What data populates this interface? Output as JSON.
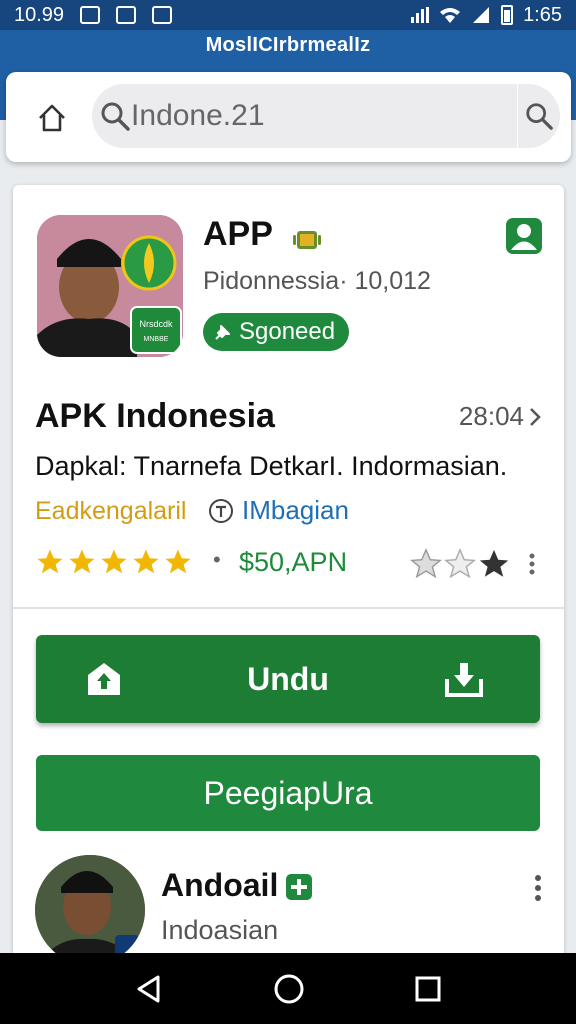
{
  "status_bar": {
    "time_left": "10.99",
    "time_right": "1:65"
  },
  "header": {
    "title": "MoslICIrbrmealIz"
  },
  "search": {
    "value": "Indone.21"
  },
  "app": {
    "title": "APP",
    "developer_line": "Pidonnessia· 10,012",
    "verified_label": "Sgoneed",
    "icon_badge_text_1": "Nrsdcdk",
    "icon_badge_text_2": "MNBBE"
  },
  "details": {
    "apk_name": "APK Indonesia",
    "time": "28:04",
    "description": "Dapkal: Tnarnefa DetkarI. Indormasian.",
    "category": "Eadkengalaril",
    "info_label": "IMbagian",
    "rating_stars": 5,
    "price": "$50,APN"
  },
  "actions": {
    "primary_label": "Undu",
    "secondary_label": "PeegiapUra"
  },
  "list": [
    {
      "title": "Andoail",
      "subtitle": "Indoasian"
    }
  ],
  "colors": {
    "header_blue": "#1f5fa4",
    "status_blue": "#17467f",
    "primary_green": "#1e7d34",
    "star_yellow": "#f2b705",
    "category_yellow": "#d39d12",
    "link_blue": "#1f6fb4"
  }
}
